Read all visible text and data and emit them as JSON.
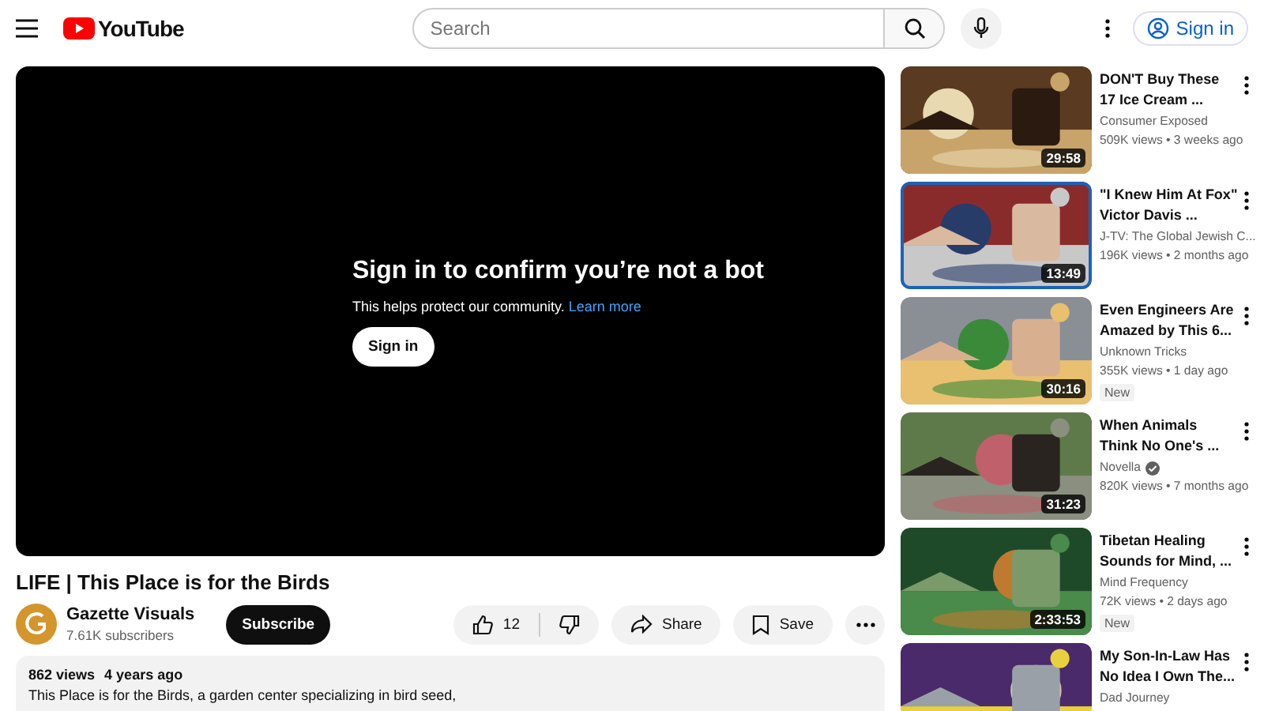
{
  "header": {
    "logo": "YouTube",
    "search": {
      "placeholder": "Search"
    },
    "sign_in": "Sign in"
  },
  "player": {
    "heading": "Sign in to confirm you’re not a bot",
    "message": "This helps protect our community.",
    "link": "Learn more",
    "button": "Sign in"
  },
  "video": {
    "title": "LIFE | This Place is for the Birds",
    "channel": "Gazette Visuals",
    "subscribers": "7.61K subscribers",
    "subscribe": "Subscribe",
    "likes": "12",
    "share": "Share",
    "save": "Save",
    "views": "862 views",
    "age": "4 years ago",
    "description": "This Place is for the Birds, a garden center specializing in bird seed,"
  },
  "recommendations": [
    {
      "title": "DON'T Buy These 17 Ice Cream ...",
      "channel": "Consumer Exposed",
      "verified": false,
      "meta": "509K views • 3 weeks ago",
      "duration": "29:58",
      "selected": false
    },
    {
      "title": "\"I Knew Him At Fox\" Victor Davis ...",
      "channel": "J-TV: The Global Jewish C...",
      "verified": false,
      "meta": "196K views • 2 months ago",
      "duration": "13:49",
      "selected": true
    },
    {
      "title": "Even Engineers Are Amazed by This 6...",
      "channel": "Unknown Tricks",
      "verified": false,
      "meta": "355K views • 1 day ago",
      "duration": "30:16",
      "badge": "New",
      "selected": false
    },
    {
      "title": "When Animals Think No One's ...",
      "channel": "Novella",
      "verified": true,
      "meta": "820K views • 7 months ago",
      "duration": "31:23",
      "selected": false
    },
    {
      "title": "Tibetan Healing Sounds  for Mind, ...",
      "channel": "Mind Frequency",
      "verified": false,
      "meta": "72K views • 2 days ago",
      "duration": "2:33:53",
      "badge": "New",
      "selected": false
    },
    {
      "title": "My Son-In-Law Has No Idea I Own The...",
      "channel": "Dad Journey",
      "verified": false,
      "selected": false
    }
  ]
}
